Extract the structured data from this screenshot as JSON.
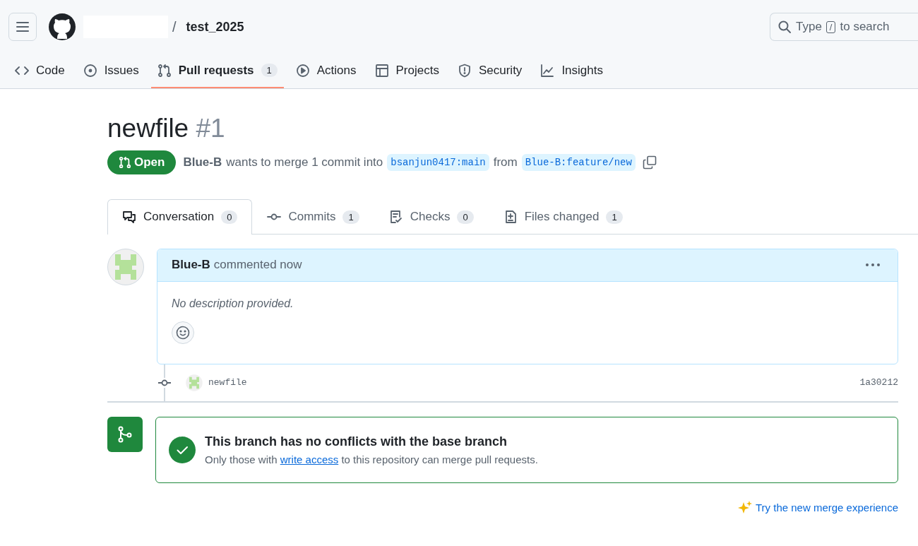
{
  "header": {
    "repo": "test_2025",
    "separator": "/",
    "search": {
      "prefix": "Type",
      "key": "/",
      "suffix": "to search"
    }
  },
  "nav": [
    {
      "label": "Code",
      "selected": false
    },
    {
      "label": "Issues",
      "selected": false
    },
    {
      "label": "Pull requests",
      "count": "1",
      "selected": true
    },
    {
      "label": "Actions",
      "selected": false
    },
    {
      "label": "Projects",
      "selected": false
    },
    {
      "label": "Security",
      "selected": false
    },
    {
      "label": "Insights",
      "selected": false
    }
  ],
  "pull_request": {
    "title": "newfile",
    "number": "#1",
    "open": true,
    "state_label": "Open",
    "author": "Blue-B",
    "summary": "wants to merge 1 commit into",
    "base_branch": "bsanjun0417:main",
    "from": "from",
    "head_branch": "Blue-B:feature/new"
  },
  "tabs": [
    {
      "label": "Conversation",
      "count": "0",
      "selected": true
    },
    {
      "label": "Commits",
      "count": "1",
      "selected": false
    },
    {
      "label": "Checks",
      "count": "0",
      "selected": false
    },
    {
      "label": "Files changed",
      "count": "1",
      "selected": false
    }
  ],
  "comment": {
    "author": "Blue-B",
    "action": "commented now",
    "body": "No description provided."
  },
  "commit": {
    "message": "newfile",
    "sha": "1a30212"
  },
  "merge_box": {
    "title": "This branch has no conflicts with the base branch",
    "text_before": "Only those with ",
    "link": "write access",
    "text_after": " to this repository can merge pull requests."
  },
  "try_link": "Try the new merge experience"
}
